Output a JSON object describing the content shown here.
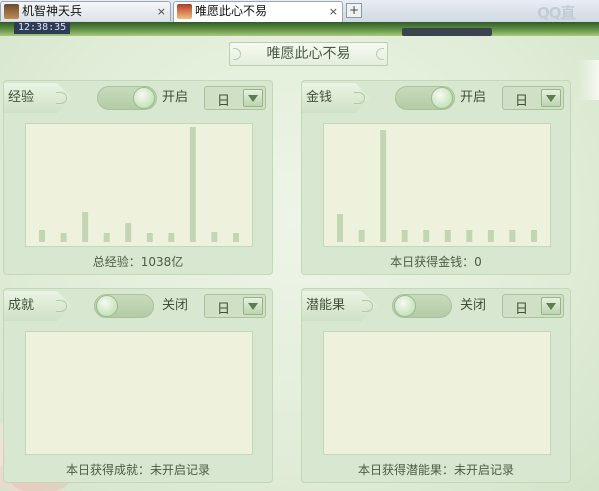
{
  "browser": {
    "tabs": [
      {
        "label": "机智神天兵",
        "active": false
      },
      {
        "label": "唯愿此心不易",
        "active": true
      }
    ],
    "close_glyph": "×",
    "new_tab_glyph": "+",
    "logo_text": "QQ直"
  },
  "game": {
    "clock": "12:38:35"
  },
  "main": {
    "title": "唯愿此心不易"
  },
  "panels": {
    "exp": {
      "tag": "经验",
      "toggle_state": "on",
      "toggle_label": "开启",
      "period": "日",
      "footer": "总经验：1038亿",
      "chart_data": {
        "type": "bar",
        "values": [
          12,
          9,
          30,
          9,
          19,
          9,
          9,
          115,
          10,
          9
        ]
      }
    },
    "money": {
      "tag": "金钱",
      "toggle_state": "on",
      "toggle_label": "开启",
      "period": "日",
      "footer": "本日获得金钱：0",
      "chart_data": {
        "type": "bar",
        "values": [
          28,
          12,
          112,
          12,
          12,
          12,
          12,
          12,
          12,
          12
        ]
      }
    },
    "achievement": {
      "tag": "成就",
      "toggle_state": "off",
      "toggle_label": "关闭",
      "period": "日",
      "footer": "本日获得成就：未开启记录"
    },
    "potential": {
      "tag": "潜能果",
      "toggle_state": "off",
      "toggle_label": "关闭",
      "period": "日",
      "footer": "本日获得潜能果：未开启记录"
    }
  },
  "colors": {
    "bar": "#c3d6b4",
    "panel_bg": "#d8e7cf",
    "chart_bg": "#eef1dc"
  }
}
